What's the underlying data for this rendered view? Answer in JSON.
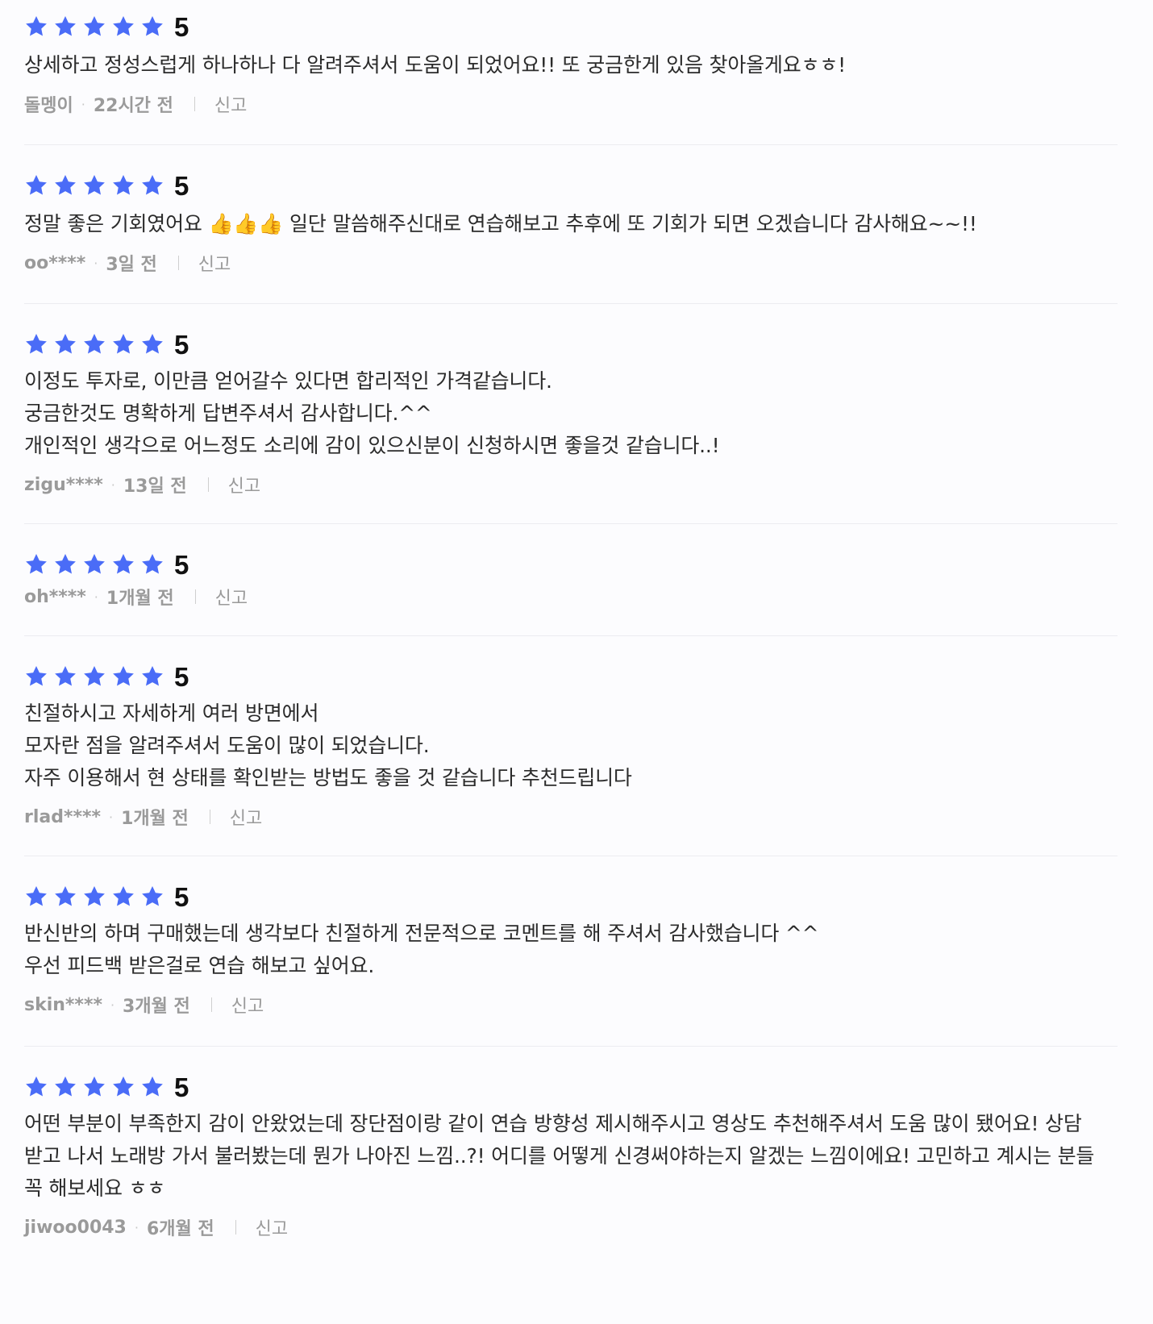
{
  "colors": {
    "star": "#4a6cf7",
    "meta_text": "#9a9a9a",
    "divider": "#ececf0",
    "background": "#fcfcfe"
  },
  "reviews": [
    {
      "stars": 5,
      "score": "5",
      "text": "상세하고 정성스럽게 하나하나 다 알려주셔서 도움이 되었어요!! 또 궁금한게 있음 찾아올게요ㅎㅎ!",
      "user": "돌멩이",
      "time": "22시간 전",
      "report": "신고"
    },
    {
      "stars": 5,
      "score": "5",
      "text": "정말 좋은 기회였어요 👍👍👍 일단 말씀해주신대로 연습해보고 추후에 또 기회가 되면 오겠습니다 감사해요~~!!",
      "user": "oo****",
      "time": "3일 전",
      "report": "신고"
    },
    {
      "stars": 5,
      "score": "5",
      "text": "이정도 투자로, 이만큼 얻어갈수 있다면 합리적인 가격같습니다.\n궁금한것도 명확하게 답변주셔서 감사합니다.^^\n개인적인 생각으로 어느정도 소리에 감이 있으신분이 신청하시면 좋을것 같습니다..!",
      "user": "zigu****",
      "time": "13일 전",
      "report": "신고"
    },
    {
      "stars": 5,
      "score": "5",
      "text": "",
      "user": "oh****",
      "time": "1개월 전",
      "report": "신고"
    },
    {
      "stars": 5,
      "score": "5",
      "text": "친절하시고 자세하게 여러 방면에서\n모자란 점을 알려주셔서 도움이 많이 되었습니다.\n자주 이용해서 현 상태를 확인받는 방법도 좋을 것 같습니다 추천드립니다",
      "user": "rlad****",
      "time": "1개월 전",
      "report": "신고"
    },
    {
      "stars": 5,
      "score": "5",
      "text": "반신반의 하며 구매했는데 생각보다 친절하게 전문적으로 코멘트를 해 주셔서 감사했습니다 ^^\n우선 피드백 받은걸로 연습 해보고 싶어요.",
      "user": "skin****",
      "time": "3개월 전",
      "report": "신고"
    },
    {
      "stars": 5,
      "score": "5",
      "text": "어떤 부분이 부족한지 감이 안왔었는데 장단점이랑 같이 연습 방향성 제시해주시고 영상도 추천해주셔서 도움 많이 됐어요! 상담\n받고 나서 노래방 가서 불러봤는데 뭔가 나아진 느낌..?! 어디를 어떻게 신경써야하는지 알겠는 느낌이에요! 고민하고 계시는 분들\n꼭 해보세요 ㅎㅎ",
      "user": "jiwoo0043",
      "time": "6개월 전",
      "report": "신고"
    }
  ]
}
